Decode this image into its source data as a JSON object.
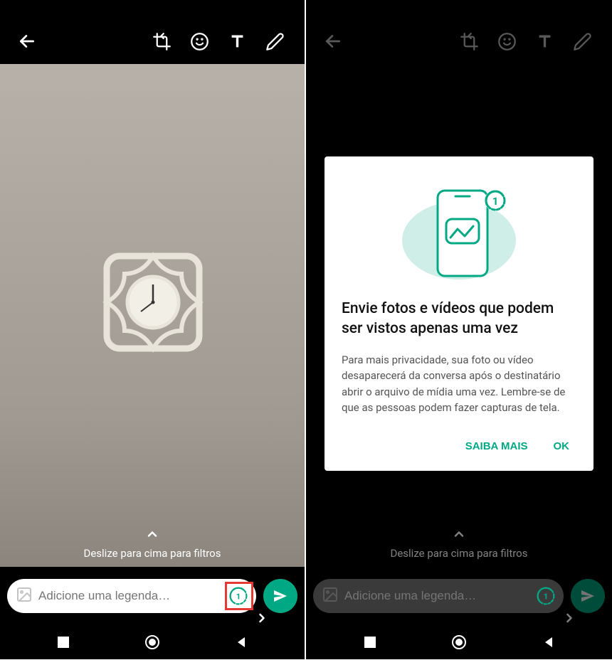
{
  "colors": {
    "accent": "#00a884",
    "highlight": "#e53935"
  },
  "swipe_hint": "Deslize para cima para filtros",
  "caption": {
    "placeholder": "Adicione uma legenda…"
  },
  "dialog": {
    "title": "Envie fotos e vídeos que podem ser vistos apenas uma vez",
    "body": "Para mais privacidade, sua foto ou vídeo desaparecerá da conversa após o destinatário abrir o arquivo de mídia uma vez. Lembre-se de que as pessoas podem fazer capturas de tela.",
    "learn_more": "SAIBA MAIS",
    "ok": "OK"
  },
  "icons": {
    "back": "back-arrow-icon",
    "crop": "crop-rotate-icon",
    "emoji": "emoji-icon",
    "text": "text-icon",
    "draw": "pencil-icon",
    "gallery": "gallery-icon",
    "view_once": "view-once-icon",
    "send": "send-icon",
    "chevron_up": "chevron-up-icon",
    "chevron_right": "chevron-right-icon",
    "nav_recent": "recent-apps-icon",
    "nav_home": "home-icon",
    "nav_back": "nav-back-icon"
  }
}
